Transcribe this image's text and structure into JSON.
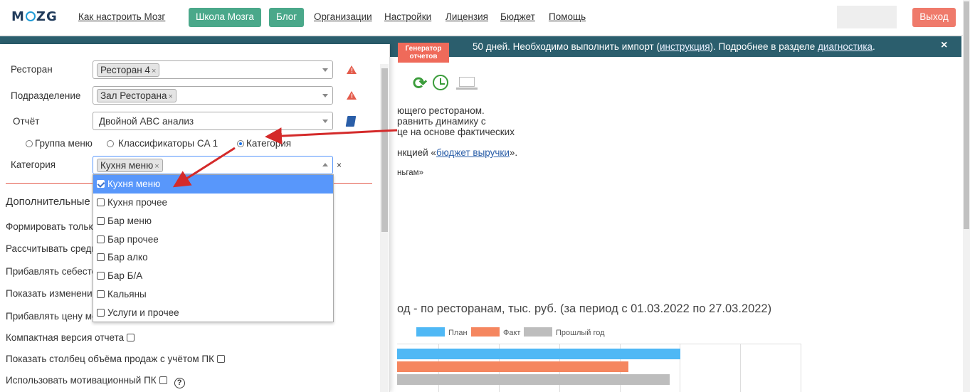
{
  "topbar": {
    "logo": "MOZG",
    "nav": [
      "Как настроить Мозг",
      "Организации",
      "Настройки",
      "Лицензия",
      "Бюджет",
      "Помощь"
    ],
    "school_label": "Школа Мозга",
    "blog_label": "Блог",
    "exit_label": "Выход"
  },
  "banner": {
    "text_before": "50 дней. Необходимо выполнить импорт (",
    "link1": "инструкция",
    "text_mid": "). Подробнее в разделе ",
    "link2": "диагностика",
    "text_after": ".",
    "close": "×"
  },
  "tag": {
    "line1": "Генератор",
    "line2": "отчетов"
  },
  "form": {
    "restaurant_label": "Ресторан",
    "restaurant_chip": "Ресторан 4",
    "division_label": "Подразделение",
    "division_chip": "Зал Ресторана",
    "report_label": "Отчёт",
    "report_value": "Двойной ABC анализ",
    "radios": [
      "Группа меню",
      "Классификаторы CA 1",
      "Категория"
    ],
    "category_label": "Категория",
    "category_chip": "Кухня меню",
    "chip_x": "×",
    "clear_x": "×",
    "warn": "!"
  },
  "dropdown": {
    "items": [
      "Кухня меню",
      "Кухня прочее",
      "Бар меню",
      "Бар прочее",
      "Бар алко",
      "Бар Б/А",
      "Кальяны",
      "Услуги и прочее"
    ]
  },
  "options": {
    "section_title": "Дополнительные",
    "items": [
      "Формировать тольк",
      "Рассчитывать средн",
      "Прибавлять себесто",
      "Показать изменени",
      "Прибавлять цену мо",
      "Компактная версия отчета",
      "Показать столбец объёма продаж с учётом ПК",
      "Использовать мотивационный ПК"
    ],
    "help": "?"
  },
  "background": {
    "text1": "ющего рестораном.",
    "text2": "равнить динамику с",
    "text3": "це на основе фактических",
    "text4_before": "нкцией «",
    "text4_link": "бюджет выручки",
    "text4_after": "».",
    "text5": "ньгам»",
    "chart_title": "од - по ресторанам, тыс. руб. (за период с 01.03.2022 по 27.03.2022)",
    "refresh_icon": "⟳"
  },
  "chart_data": {
    "type": "bar",
    "series": [
      {
        "name": "План",
        "color": "#4fb8f5"
      },
      {
        "name": "Факт",
        "color": "#f5865f"
      },
      {
        "name": "Прошлый год",
        "color": "#bdbdbd"
      }
    ]
  }
}
